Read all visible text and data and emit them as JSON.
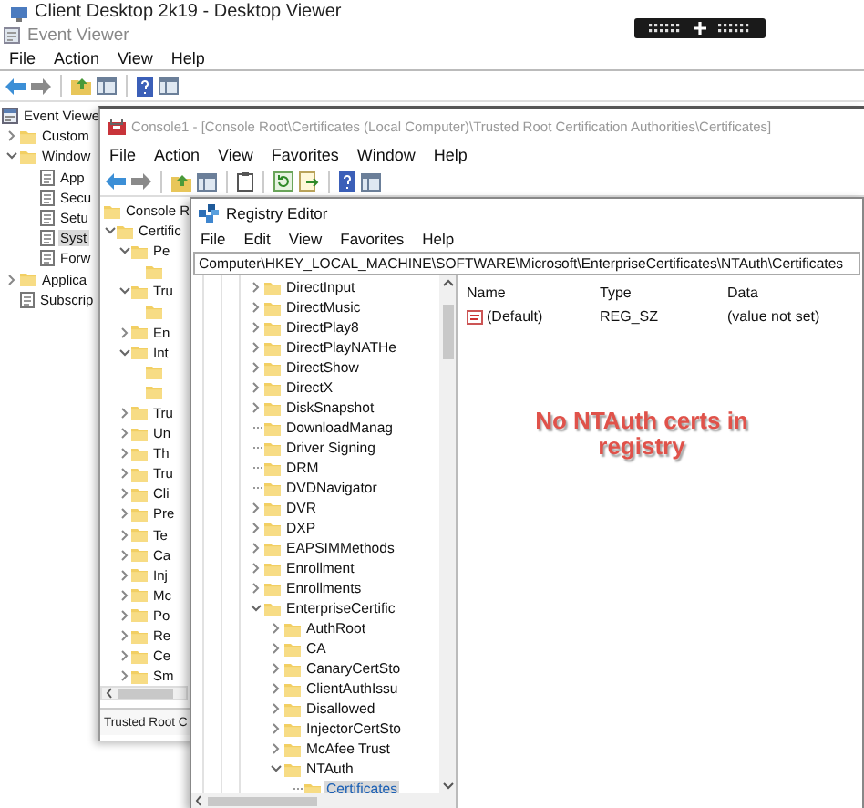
{
  "desktop_viewer": {
    "title": "Client Desktop 2k19 - Desktop Viewer"
  },
  "event_viewer": {
    "title": "Event Viewer",
    "menu": [
      "File",
      "Action",
      "View",
      "Help"
    ],
    "tree": [
      {
        "label": "Event Viewe",
        "kind": "root",
        "selected": false,
        "children": [
          {
            "label": "Custom",
            "kind": "node",
            "expanded": false,
            "selected": false
          },
          {
            "label": "Window",
            "kind": "node",
            "expanded": true,
            "selected": false,
            "children": [
              {
                "label": "App",
                "kind": "leaf",
                "selected": false
              },
              {
                "label": "Secu",
                "kind": "leaf",
                "selected": false
              },
              {
                "label": "Setu",
                "kind": "leaf",
                "selected": false
              },
              {
                "label": "Syst",
                "kind": "leaf",
                "selected": true
              },
              {
                "label": "Forw",
                "kind": "leaf",
                "selected": false
              }
            ]
          },
          {
            "label": "Applica",
            "kind": "node",
            "expanded": false,
            "selected": false
          },
          {
            "label": "Subscrip",
            "kind": "leaf",
            "selected": false
          }
        ]
      }
    ]
  },
  "console": {
    "title": "Console1 - [Console Root\\Certificates (Local Computer)\\Trusted Root Certification Authorities\\Certificates]",
    "menu": [
      "File",
      "Action",
      "View",
      "Favorites",
      "Window",
      "Help"
    ],
    "tree": [
      {
        "label": "Console R",
        "kind": "root",
        "children": [
          {
            "label": "Certific",
            "kind": "node",
            "expanded": true,
            "children": [
              {
                "label": "Pe",
                "kind": "node",
                "expanded": true,
                "children": [
                  {
                    "kind": "covered"
                  }
                ]
              },
              {
                "label": "Tru",
                "kind": "node",
                "expanded": true,
                "children": [
                  {
                    "kind": "covered"
                  }
                ]
              },
              {
                "label": "En",
                "kind": "node",
                "expanded": false
              },
              {
                "label": "Int",
                "kind": "node",
                "expanded": true,
                "children": [
                  {
                    "kind": "covered"
                  },
                  {
                    "kind": "covered"
                  }
                ]
              },
              {
                "label": "Tru",
                "kind": "node",
                "expanded": false
              },
              {
                "label": "Un",
                "kind": "node",
                "expanded": false
              },
              {
                "label": "Th",
                "kind": "node",
                "expanded": false
              },
              {
                "label": "Tru",
                "kind": "node",
                "expanded": false
              },
              {
                "label": "Cli",
                "kind": "node",
                "expanded": false
              },
              {
                "label": "Pre",
                "kind": "node",
                "expanded": false
              },
              {
                "label": "Te",
                "kind": "node",
                "expanded": false
              },
              {
                "label": "Ca",
                "kind": "node",
                "expanded": false
              },
              {
                "label": "Inj",
                "kind": "node",
                "expanded": false
              },
              {
                "label": "Mc",
                "kind": "node",
                "expanded": false
              },
              {
                "label": "Po",
                "kind": "node",
                "expanded": false
              },
              {
                "label": "Re",
                "kind": "node",
                "expanded": false
              },
              {
                "label": "Ce",
                "kind": "node",
                "expanded": false
              },
              {
                "label": "Sm",
                "kind": "node",
                "expanded": false
              }
            ]
          }
        ]
      }
    ],
    "status_bar": "Trusted Root C"
  },
  "registry_editor": {
    "title": "Registry Editor",
    "menu": [
      "File",
      "Edit",
      "View",
      "Favorites",
      "Help"
    ],
    "address": "Computer\\HKEY_LOCAL_MACHINE\\SOFTWARE\\Microsoft\\EnterpriseCertificates\\NTAuth\\Certificates",
    "tree": [
      {
        "label": "DirectInput",
        "kind": "node",
        "expanded": false,
        "selected": false
      },
      {
        "label": "DirectMusic",
        "kind": "node",
        "expanded": false,
        "selected": false
      },
      {
        "label": "DirectPlay8",
        "kind": "node",
        "expanded": false,
        "selected": false
      },
      {
        "label": "DirectPlayNATHe",
        "kind": "node",
        "expanded": false,
        "selected": false
      },
      {
        "label": "DirectShow",
        "kind": "node",
        "expanded": false,
        "selected": false
      },
      {
        "label": "DirectX",
        "kind": "node",
        "expanded": false,
        "selected": false
      },
      {
        "label": "DiskSnapshot",
        "kind": "node",
        "expanded": false,
        "selected": false
      },
      {
        "label": "DownloadManag",
        "kind": "leaf",
        "selected": false
      },
      {
        "label": "Driver Signing",
        "kind": "leaf",
        "selected": false
      },
      {
        "label": "DRM",
        "kind": "leaf",
        "selected": false
      },
      {
        "label": "DVDNavigator",
        "kind": "leaf",
        "selected": false
      },
      {
        "label": "DVR",
        "kind": "node",
        "expanded": false,
        "selected": false
      },
      {
        "label": "DXP",
        "kind": "node",
        "expanded": false,
        "selected": false
      },
      {
        "label": "EAPSIMMethods",
        "kind": "node",
        "expanded": false,
        "selected": false
      },
      {
        "label": "Enrollment",
        "kind": "node",
        "expanded": false,
        "selected": false
      },
      {
        "label": "Enrollments",
        "kind": "node",
        "expanded": false,
        "selected": false
      },
      {
        "label": "EnterpriseCertific",
        "kind": "node",
        "expanded": true,
        "selected": false,
        "children": [
          {
            "label": "AuthRoot",
            "kind": "node",
            "expanded": false,
            "selected": false
          },
          {
            "label": "CA",
            "kind": "node",
            "expanded": false,
            "selected": false
          },
          {
            "label": "CanaryCertSto",
            "kind": "node",
            "expanded": false,
            "selected": false
          },
          {
            "label": "ClientAuthIssu",
            "kind": "node",
            "expanded": false,
            "selected": false
          },
          {
            "label": "Disallowed",
            "kind": "node",
            "expanded": false,
            "selected": false
          },
          {
            "label": "InjectorCertSto",
            "kind": "node",
            "expanded": false,
            "selected": false
          },
          {
            "label": "McAfee Trust",
            "kind": "node",
            "expanded": false,
            "selected": false
          },
          {
            "label": "NTAuth",
            "kind": "node",
            "expanded": true,
            "selected": false,
            "children": [
              {
                "label": "Certificates",
                "kind": "leaf",
                "selected": true
              }
            ]
          }
        ]
      }
    ],
    "columns": [
      "Name",
      "Type",
      "Data"
    ],
    "rows": [
      {
        "name": "(Default)",
        "type": "REG_SZ",
        "data": "(value not set)"
      }
    ]
  },
  "annotation": {
    "text": "No NTAuth certs in registry"
  }
}
